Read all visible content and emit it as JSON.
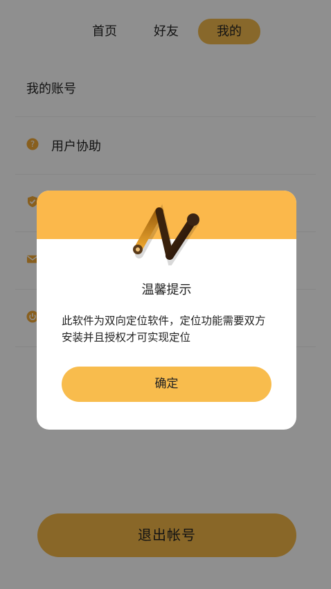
{
  "tabs": [
    {
      "label": "首页",
      "active": false
    },
    {
      "label": "好友",
      "active": false
    },
    {
      "label": "我的",
      "active": true
    }
  ],
  "menu": {
    "account": "我的账号",
    "help": "用户协助"
  },
  "logout_label": "退出帐号",
  "dialog": {
    "title": "温馨提示",
    "message": "此软件为双向定位软件，定位功能需要双方安装并且授权才可实现定位",
    "confirm_label": "确定"
  },
  "colors": {
    "accent": "#f5b848",
    "overlay": "rgba(0,0,0,0.44)",
    "logo_dark": "#2c1a10",
    "logo_gold": "#c58a1b"
  },
  "icons": {
    "help": "help-circle-icon",
    "security": "shield-check-icon",
    "mail": "mail-icon",
    "power": "power-icon",
    "logo": "zigzag-location-logo"
  }
}
